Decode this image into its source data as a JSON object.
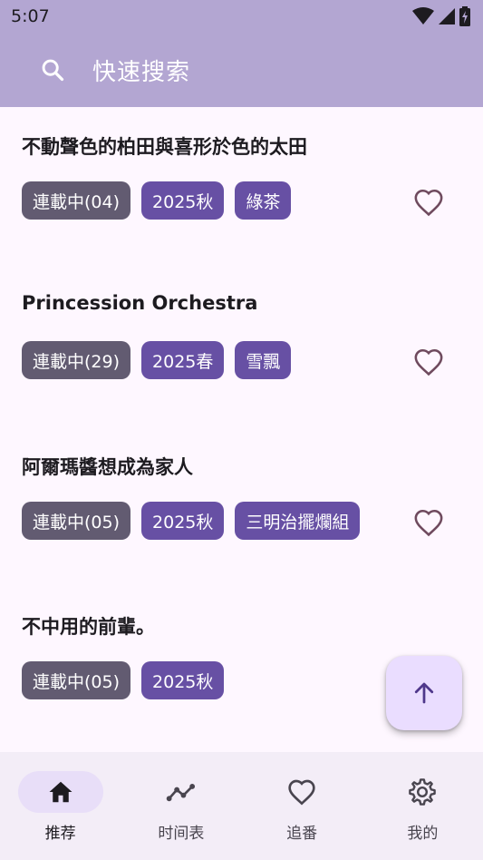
{
  "status_bar": {
    "time": "5:07"
  },
  "search": {
    "placeholder": "快速搜索"
  },
  "items": [
    {
      "title": "不動聲色的柏田與喜形於色的太田",
      "status": "連載中(04)",
      "season": "2025秋",
      "group": "綠茶"
    },
    {
      "title": "Princession Orchestra",
      "status": "連載中(29)",
      "season": "2025春",
      "group": "雪飄"
    },
    {
      "title": "阿爾瑪醬想成為家人",
      "status": "連載中(05)",
      "season": "2025秋",
      "group": "三明治擺爛組"
    },
    {
      "title": "不中用的前輩。",
      "status": "連載中(05)",
      "season": "2025秋"
    }
  ],
  "nav": {
    "items": [
      {
        "label": "推荐",
        "icon": "home-icon",
        "active": true
      },
      {
        "label": "时间表",
        "icon": "timeline-icon",
        "active": false
      },
      {
        "label": "追番",
        "icon": "heart-icon",
        "active": false
      },
      {
        "label": "我的",
        "icon": "gear-icon",
        "active": false
      }
    ]
  },
  "colors": {
    "appbar": "#B3A6D2",
    "background": "#FEF7FF",
    "status_tag": "#625B71",
    "primary_tag": "#6750A4",
    "fab": "#EADDFF",
    "nav_bg": "#F3EDF7",
    "nav_active_pill": "#E8DEF8"
  },
  "fab": {
    "icon": "arrow-up-icon"
  }
}
